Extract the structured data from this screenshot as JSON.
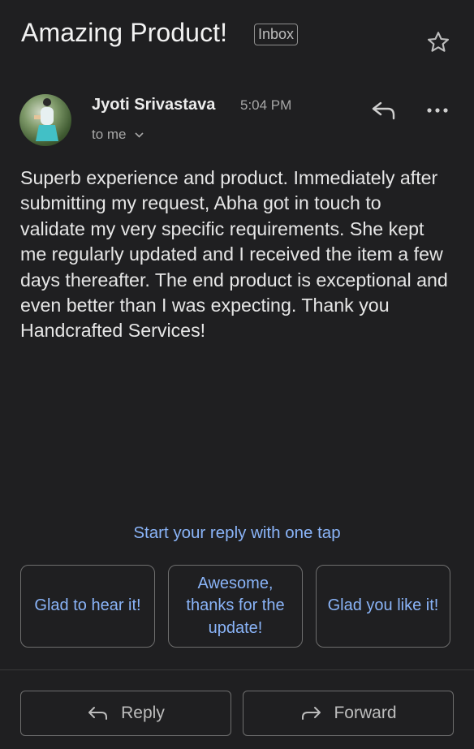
{
  "message": {
    "subject": "Amazing Product!",
    "label": "Inbox",
    "sender_name": "Jyoti Srivastava",
    "time": "5:04 PM",
    "recipient": "to me",
    "body": "Superb experience and product. Immediately after submitting my request, Abha got in touch to validate my very specific requirements. She kept me regularly updated and I received the item a few days thereafter. The end product is exceptional and even better than I was expecting. Thank you Handcrafted Services!"
  },
  "smart_reply": {
    "prompt": "Start your reply with one tap",
    "chips": [
      {
        "label": "Glad to hear it!"
      },
      {
        "label": "Awesome, thanks for the update!"
      },
      {
        "label": "Glad you like it!"
      }
    ]
  },
  "actions": {
    "reply_label": "Reply",
    "forward_label": "Forward"
  },
  "icons": {
    "star": "star-icon",
    "reply": "reply-icon",
    "more": "more-horizontal-icon",
    "chevron": "chevron-down-icon",
    "forward": "forward-icon"
  },
  "colors": {
    "background": "#1f1f21",
    "accent": "#8ab4f8",
    "text": "#e6e6e6",
    "muted": "#a7a7a7",
    "border": "#6e6e6e"
  }
}
